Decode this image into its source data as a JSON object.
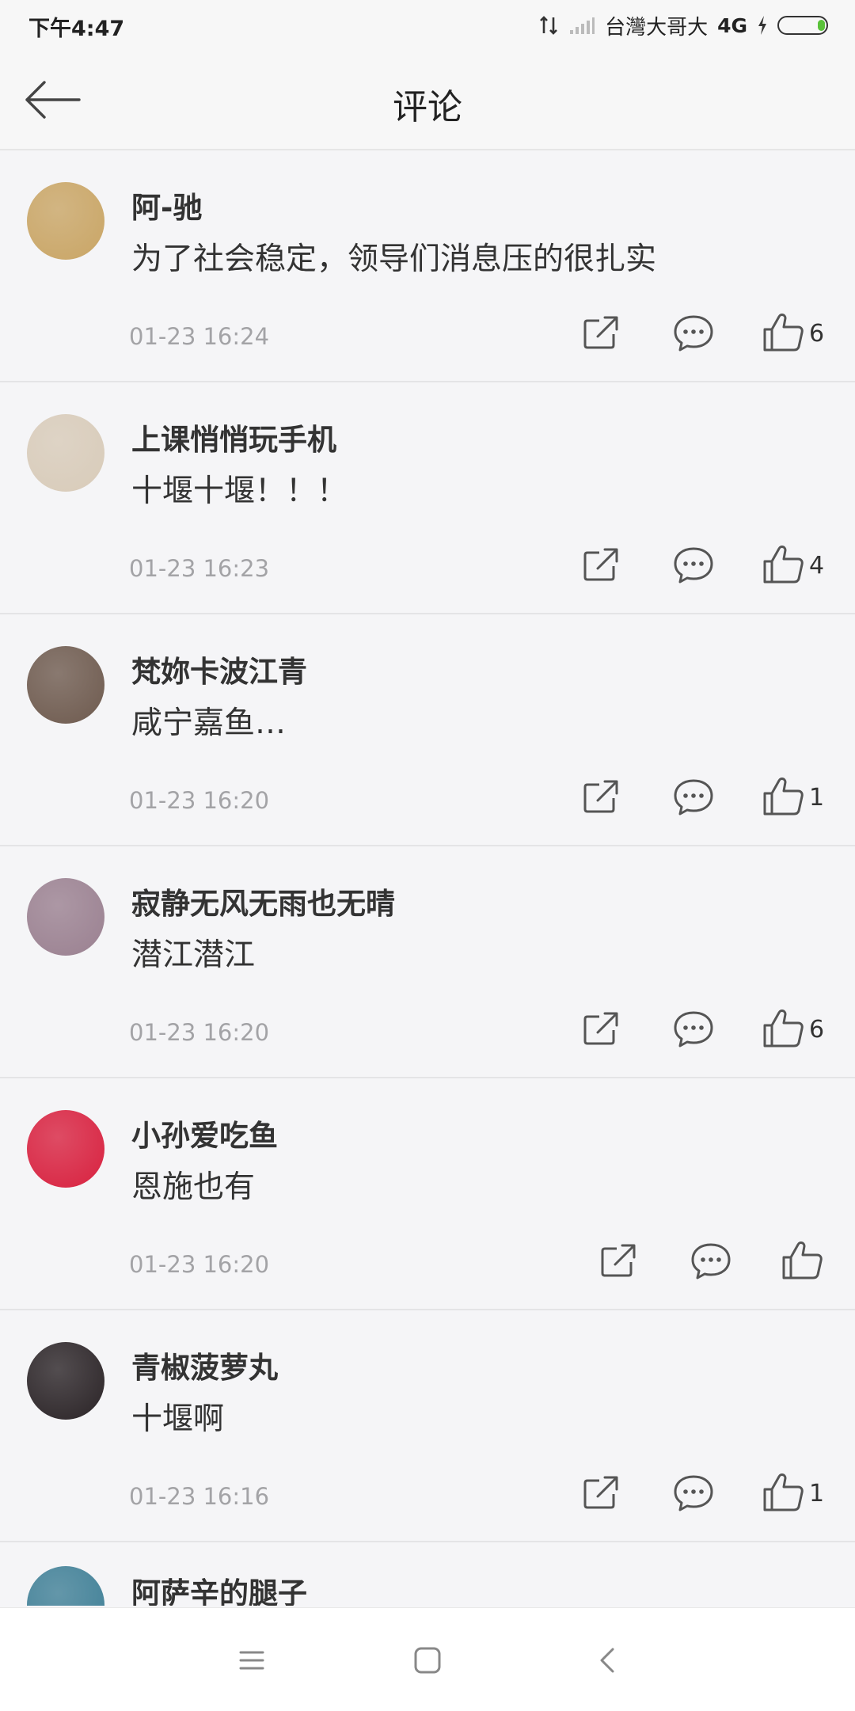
{
  "status_bar": {
    "time": "下午4:47",
    "carrier": "台灣大哥大",
    "network": "4G",
    "battery_color": "#5ac23a"
  },
  "header": {
    "title": "评论",
    "back_icon": "arrow-left-icon"
  },
  "comments": [
    {
      "username": "阿-驰",
      "text": "为了社会稳定，领导们消息压的很扎实",
      "time": "01-23 16:24",
      "likes": "6",
      "avatar_color": "#c9a565"
    },
    {
      "username": "上课悄悄玩手机",
      "text": "十堰十堰！！！",
      "time": "01-23 16:23",
      "likes": "4",
      "avatar_color": "#d8cbb9"
    },
    {
      "username": "梵妳卡波江青",
      "text": "咸宁嘉鱼…",
      "time": "01-23 16:20",
      "likes": "1",
      "avatar_color": "#6e5a4e"
    },
    {
      "username": "寂静无风无雨也无晴",
      "text": "潜江潜江",
      "time": "01-23 16:20",
      "likes": "6",
      "avatar_color": "#9a8090"
    },
    {
      "username": "小孙爱吃鱼",
      "text": "恩施也有",
      "time": "01-23 16:20",
      "likes": "",
      "avatar_color": "#d8213f"
    },
    {
      "username": "青椒菠萝丸",
      "text": "十堰啊",
      "time": "01-23 16:16",
      "likes": "1",
      "avatar_color": "#2a2326"
    },
    {
      "username": "阿萨辛的腿子",
      "avatar_color": "#3f7f96"
    }
  ],
  "nav": {
    "menu_icon": "menu-icon",
    "home_icon": "home-square-icon",
    "back_icon": "back-chevron-icon"
  }
}
